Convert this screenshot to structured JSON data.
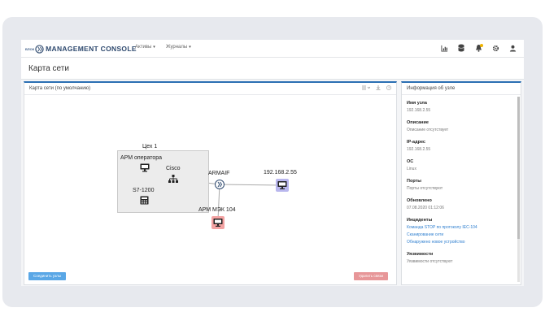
{
  "brand": {
    "small": "БЛОК",
    "title": "MANAGEMENT CONSOLE"
  },
  "nav": [
    {
      "label": "Активы"
    },
    {
      "label": "Журналы"
    }
  ],
  "toolbar_icons": [
    "chart-icon",
    "database-icon",
    "bell-icon",
    "gear-icon",
    "user-icon"
  ],
  "page": {
    "title": "Карта сети"
  },
  "map_panel": {
    "title": "Карта сети (по умолчанию)",
    "group_label": "Цех 1",
    "nodes": {
      "operator": "АРМ оператора",
      "cisco": "Cisco",
      "s7": "S7-1200",
      "armaif": "ARMAIF",
      "ip": "192.168.2.55",
      "mek": "АРМ МЭК 104"
    },
    "buttons": {
      "connect": "Соединить узлы",
      "delete": "Удалить связи"
    },
    "colors": {
      "selected_node": "#b9b7ee",
      "alert_node": "#f3a3a3",
      "accent": "#2b6fb3"
    }
  },
  "info_panel": {
    "title": "Информация об узле",
    "fields": [
      {
        "label": "Имя узла",
        "value": "192.168.2.55"
      },
      {
        "label": "Описание",
        "value": "Описание отсутствует"
      },
      {
        "label": "IP-адрес",
        "value": "192.168.2.55"
      },
      {
        "label": "ОС",
        "value": "Linux"
      },
      {
        "label": "Порты",
        "value": "Порты отсутствуют"
      },
      {
        "label": "Обновлено",
        "value": "07.08.2020 01:12:06"
      }
    ],
    "incidents_label": "Инциденты",
    "incidents": [
      "Команда STOP по протоколу IEC-104",
      "Сканирование сети",
      "Обнаружено новое устройство"
    ],
    "vuln_label": "Уязвимости",
    "vuln_value": "Уязвимости отсутствуют"
  }
}
